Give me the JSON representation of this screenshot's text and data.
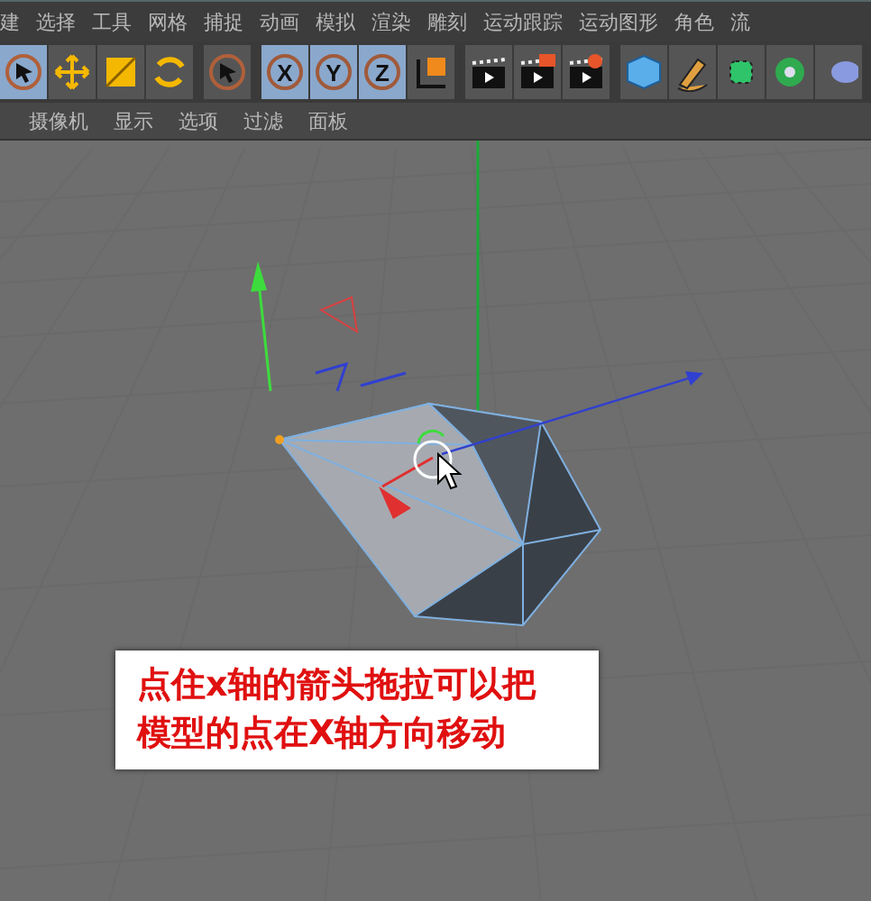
{
  "menu_bar": [
    "建",
    "选择",
    "工具",
    "网格",
    "捕捉",
    "动画",
    "模拟",
    "渲染",
    "雕刻",
    "运动跟踪",
    "运动图形",
    "角色",
    "流"
  ],
  "toolbar": [
    [
      {
        "kind": "select",
        "active": true
      },
      {
        "kind": "move",
        "active": false
      },
      {
        "kind": "scale",
        "active": false
      },
      {
        "kind": "rotate",
        "active": false
      }
    ],
    [
      {
        "kind": "live-select",
        "active": false
      }
    ],
    [
      {
        "kind": "axis",
        "label": "X",
        "active": true
      },
      {
        "kind": "axis",
        "label": "Y",
        "active": true
      },
      {
        "kind": "axis",
        "label": "Z",
        "active": true
      },
      {
        "kind": "coords",
        "active": false
      }
    ],
    [
      {
        "kind": "render-view",
        "active": false
      },
      {
        "kind": "render",
        "active": false
      },
      {
        "kind": "render-settings",
        "active": false
      }
    ],
    [
      {
        "kind": "cube",
        "active": false
      },
      {
        "kind": "pen",
        "active": false
      },
      {
        "kind": "subdivision",
        "active": false
      },
      {
        "kind": "cloner",
        "active": false
      },
      {
        "kind": "deformer",
        "active": false
      }
    ]
  ],
  "viewport_menu": [
    "摄像机",
    "显示",
    "选项",
    "过滤",
    "面板"
  ],
  "caption": {
    "lines": [
      "点住x轴的箭头拖拉可以把",
      "模型的点在X轴方向移动"
    ]
  }
}
